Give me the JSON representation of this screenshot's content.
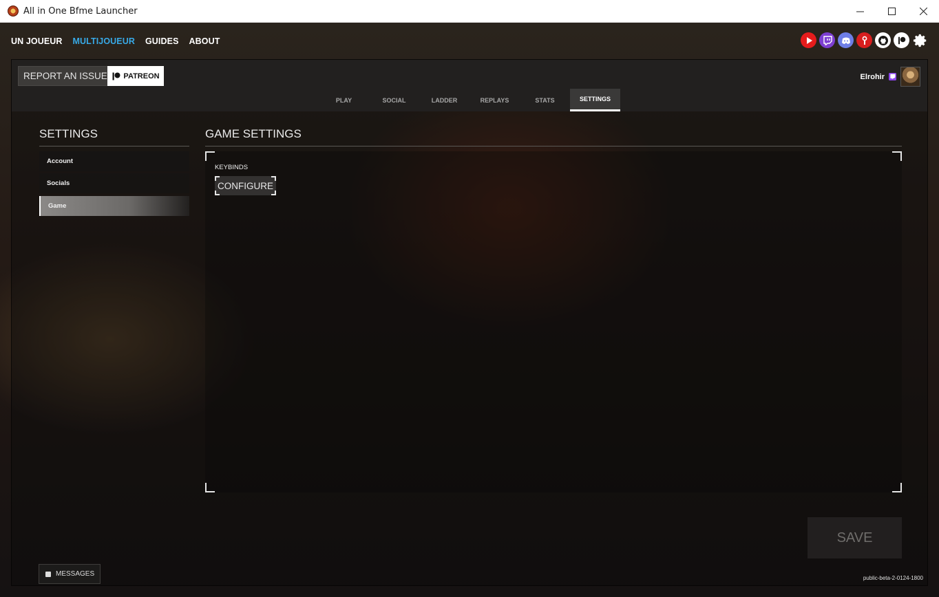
{
  "window": {
    "title": "All in One Bfme Launcher",
    "controls": [
      "minimize",
      "maximize",
      "close"
    ]
  },
  "topnav": {
    "items": [
      {
        "label": "UN JOUEUR",
        "active": false
      },
      {
        "label": "MULTIJOUEUR",
        "active": true
      },
      {
        "label": "GUIDES",
        "active": false
      },
      {
        "label": "ABOUT",
        "active": false
      }
    ],
    "active_color": "#38a9e6"
  },
  "social_icons": [
    {
      "name": "youtube-icon",
      "color": "#e61c1c"
    },
    {
      "name": "twitch-icon",
      "color": "#7d3fd1"
    },
    {
      "name": "discord-icon",
      "color": "#6e7ee6"
    },
    {
      "name": "modding-tool-icon",
      "color": "#d81e1e"
    },
    {
      "name": "github-icon",
      "color": "#ffffff"
    },
    {
      "name": "patreon-icon",
      "color": "#ffffff"
    },
    {
      "name": "settings-gear-icon",
      "color": "#ffffff"
    }
  ],
  "header": {
    "report_label": "REPORT AN ISSUE",
    "patreon_label": "PATREON",
    "username": "Elrohir"
  },
  "tabs": [
    {
      "label": "PLAY",
      "active": false
    },
    {
      "label": "SOCIAL",
      "active": false
    },
    {
      "label": "LADDER",
      "active": false
    },
    {
      "label": "REPLAYS",
      "active": false
    },
    {
      "label": "STATS",
      "active": false
    },
    {
      "label": "SETTINGS",
      "active": true
    }
  ],
  "sidebar": {
    "title": "SETTINGS",
    "items": [
      {
        "label": "Account",
        "active": false
      },
      {
        "label": "Socials",
        "active": false
      },
      {
        "label": "Game",
        "active": true
      }
    ]
  },
  "game_settings": {
    "title": "GAME SETTINGS",
    "keybinds_label": "KEYBINDS",
    "configure_label": "CONFIGURE"
  },
  "footer": {
    "save_label": "SAVE",
    "messages_label": "MESSAGES",
    "version": "public-beta-2-0124-1800"
  }
}
